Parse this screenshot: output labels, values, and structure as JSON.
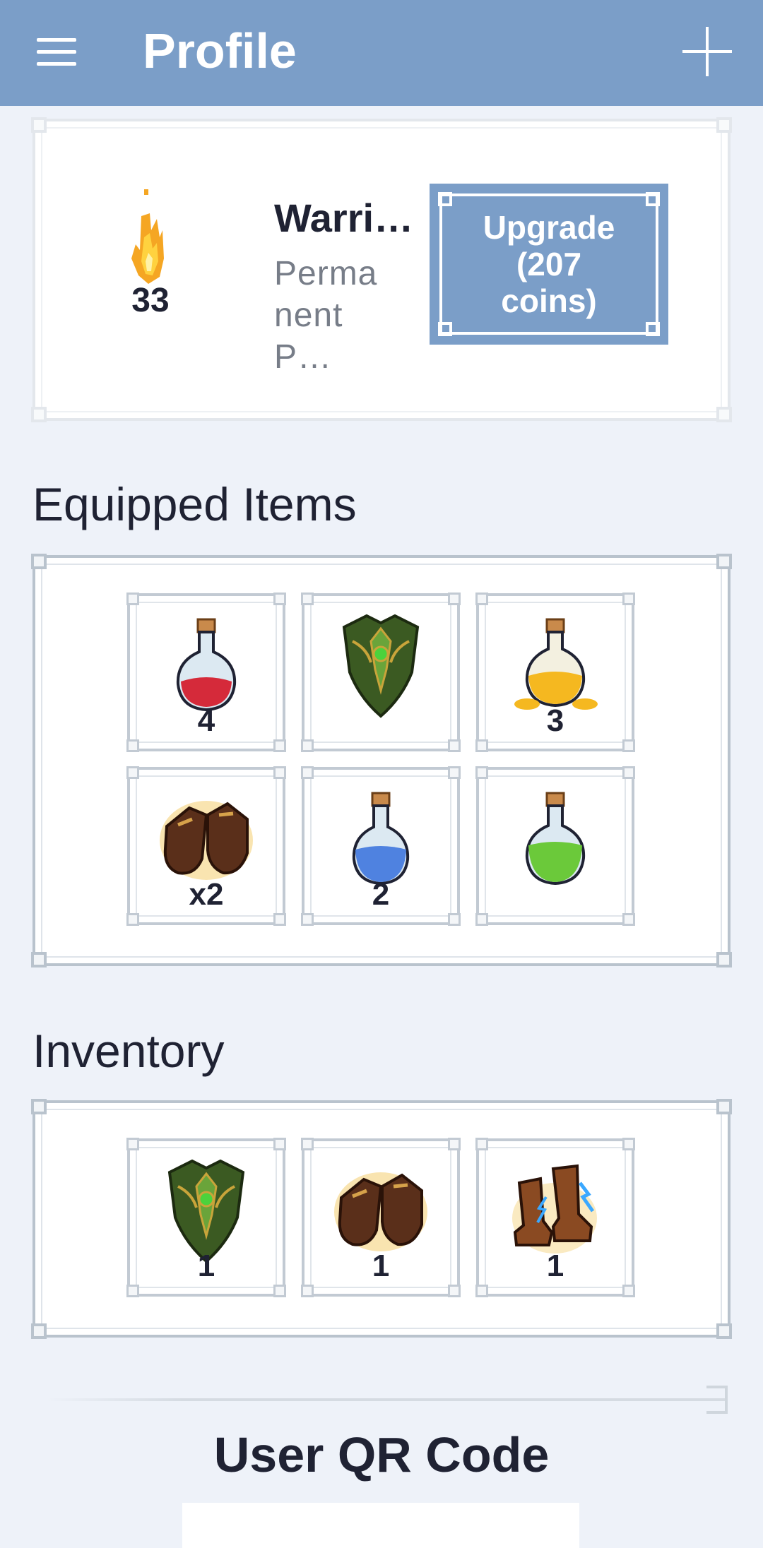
{
  "app_bar": {
    "title": "Profile",
    "menu_icon": "hamburger-menu-icon",
    "action_icon": "plus-icon"
  },
  "profile_card": {
    "streak_count": "33",
    "class_name": "Warri…",
    "description_line1": "Perma",
    "description_line2": "nent P…",
    "upgrade_line1": "Upgrade",
    "upgrade_line2": "(207",
    "upgrade_line3": "coins)"
  },
  "equipped": {
    "title": "Equipped Items",
    "items": [
      {
        "icon": "red-potion-icon",
        "qty": "4"
      },
      {
        "icon": "green-shield-icon",
        "qty": ""
      },
      {
        "icon": "gold-potion-icon",
        "qty": "3"
      },
      {
        "icon": "leather-gloves-icon",
        "qty": "x2"
      },
      {
        "icon": "blue-potion-icon",
        "qty": "2"
      },
      {
        "icon": "green-potion-icon",
        "qty": ""
      }
    ]
  },
  "inventory": {
    "title": "Inventory",
    "items": [
      {
        "icon": "green-shield-icon",
        "qty": "1"
      },
      {
        "icon": "leather-gloves-icon",
        "qty": "1"
      },
      {
        "icon": "lightning-boots-icon",
        "qty": "1"
      }
    ]
  },
  "qr": {
    "title": "User QR Code"
  },
  "colors": {
    "app_bar": "#7b9ec8",
    "background": "#eef2f9",
    "text": "#1f2233"
  }
}
